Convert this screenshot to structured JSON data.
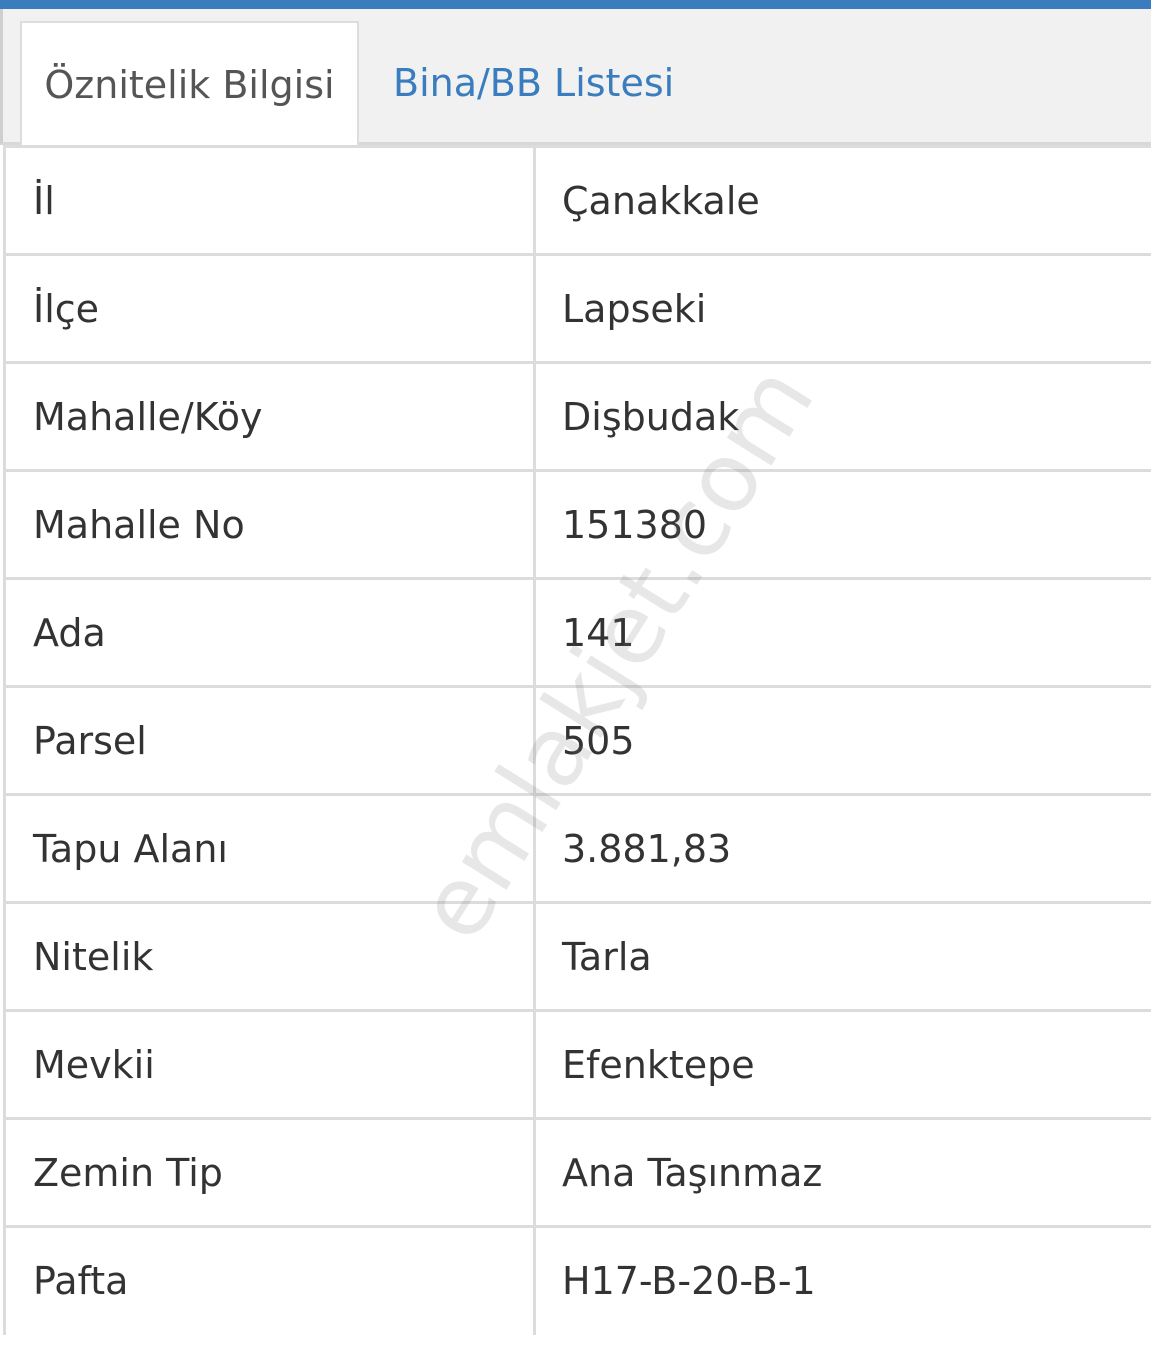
{
  "tabs": [
    {
      "label": "Öznitelik Bilgisi",
      "active": true
    },
    {
      "label": "Bina/BB Listesi",
      "active": false
    }
  ],
  "rows": [
    {
      "label": "İl",
      "value": "Çanakkale"
    },
    {
      "label": "İlçe",
      "value": "Lapseki"
    },
    {
      "label": "Mahalle/Köy",
      "value": "Dişbudak"
    },
    {
      "label": "Mahalle No",
      "value": "151380"
    },
    {
      "label": "Ada",
      "value": "141"
    },
    {
      "label": "Parsel",
      "value": "505"
    },
    {
      "label": "Tapu Alanı",
      "value": "3.881,83"
    },
    {
      "label": "Nitelik",
      "value": "Tarla"
    },
    {
      "label": "Mevkii",
      "value": "Efenktepe"
    },
    {
      "label": "Zemin Tip",
      "value": "Ana Taşınmaz"
    },
    {
      "label": "Pafta",
      "value": "H17-B-20-B-1"
    }
  ],
  "watermark": "emlakjet.com",
  "colors": {
    "accent": "#3a7dbf",
    "text": "#333333",
    "border": "#dcdcdc"
  }
}
